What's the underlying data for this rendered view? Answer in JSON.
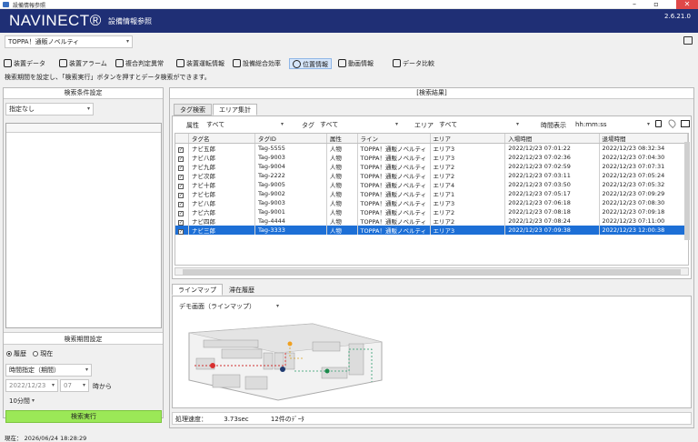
{
  "window": {
    "title": "設備情報参照",
    "min": "–",
    "max": "▫",
    "close": "✕"
  },
  "header": {
    "logo": "NAVINECT®",
    "subtitle": "設備情報参照",
    "version": "2.6.21.0"
  },
  "org_select": {
    "value": "TOPPA！通販ノベルティ"
  },
  "toolbar": [
    {
      "label": "装置データ",
      "icon": "robot-arm-icon"
    },
    {
      "label": "装置アラーム",
      "icon": "alarm-icon"
    },
    {
      "label": "複合判定異常",
      "icon": "warning-person-icon"
    },
    {
      "label": "装置運転情報",
      "icon": "operation-icon"
    },
    {
      "label": "設備総合効率",
      "icon": "efficiency-chart-icon"
    },
    {
      "label": "位置情報",
      "icon": "location-pin-icon"
    },
    {
      "label": "動画情報",
      "icon": "video-icon"
    },
    {
      "label": "データ比較",
      "icon": "compare-icon"
    }
  ],
  "hint": "検索期間を設定し、「検索実行」ボタンを押すとデータ検索ができます。",
  "left_panel": {
    "title": "検索条件設定",
    "condition_select": "指定なし",
    "period_title": "検索期間設定",
    "radio_history": "履歴",
    "radio_now": "現在",
    "period_mode": "時間指定（期間）",
    "date": "2022/12/23",
    "hour": "07",
    "from_label": "時から",
    "duration": "10分間",
    "search_button": "検索実行"
  },
  "right_panel": {
    "title": "[検索結果]",
    "tabs": [
      "タグ検索",
      "エリア集計"
    ],
    "filters": {
      "attr_label": "属性",
      "attr_value": "すべて",
      "tag_label": "タグ",
      "tag_value": "すべて",
      "area_label": "エリア",
      "area_value": "すべて",
      "time_label": "時間表示",
      "time_value": "hh:mm:ss"
    },
    "columns": [
      "タグ名",
      "タグID",
      "属性",
      "ライン",
      "エリア",
      "入場時間",
      "退場時間"
    ],
    "rows": [
      [
        "ナビ五郎",
        "Tag-5555",
        "人物",
        "TOPPA！通販ノベルティ",
        "エリア3",
        "2022/12/23 07:01:22",
        "2022/12/23 08:32:34"
      ],
      [
        "ナビ八郎",
        "Tag-9003",
        "人物",
        "TOPPA！通販ノベルティ",
        "エリア3",
        "2022/12/23 07:02:36",
        "2022/12/23 07:04:30"
      ],
      [
        "ナビ九郎",
        "Tag-9004",
        "人物",
        "TOPPA！通販ノベルティ",
        "エリア2",
        "2022/12/23 07:02:59",
        "2022/12/23 07:07:31"
      ],
      [
        "ナビ次郎",
        "Tag-2222",
        "人物",
        "TOPPA！通販ノベルティ",
        "エリア2",
        "2022/12/23 07:03:11",
        "2022/12/23 07:05:24"
      ],
      [
        "ナビ十郎",
        "Tag-9005",
        "人物",
        "TOPPA！通販ノベルティ",
        "エリア4",
        "2022/12/23 07:03:50",
        "2022/12/23 07:05:32"
      ],
      [
        "ナビ七郎",
        "Tag-9002",
        "人物",
        "TOPPA！通販ノベルティ",
        "エリア1",
        "2022/12/23 07:05:17",
        "2022/12/23 07:09:29"
      ],
      [
        "ナビ八郎",
        "Tag-9003",
        "人物",
        "TOPPA！通販ノベルティ",
        "エリア3",
        "2022/12/23 07:06:18",
        "2022/12/23 07:08:30"
      ],
      [
        "ナビ六郎",
        "Tag-9001",
        "人物",
        "TOPPA！通販ノベルティ",
        "エリア2",
        "2022/12/23 07:08:18",
        "2022/12/23 07:09:18"
      ],
      [
        "ナビ四郎",
        "Tag-4444",
        "人物",
        "TOPPA！通販ノベルティ",
        "エリア2",
        "2022/12/23 07:08:24",
        "2022/12/23 07:11:00"
      ],
      [
        "ナビ三郎",
        "Tag-3333",
        "人物",
        "TOPPA！通販ノベルティ",
        "エリア3",
        "2022/12/23 07:09:38",
        "2022/12/23 12:00:38"
      ]
    ],
    "selected_row": 9,
    "lower_tabs": [
      "ラインマップ",
      "滞在履歴"
    ],
    "map_select": "デモ画面（ラインマップ）",
    "status": {
      "speed_label": "処理速度：",
      "speed_value": "3.73sec",
      "count": "12件のﾃﾞｰﾀ"
    }
  },
  "footer": {
    "now": "現在： 2026/06/24 18:28:29"
  }
}
